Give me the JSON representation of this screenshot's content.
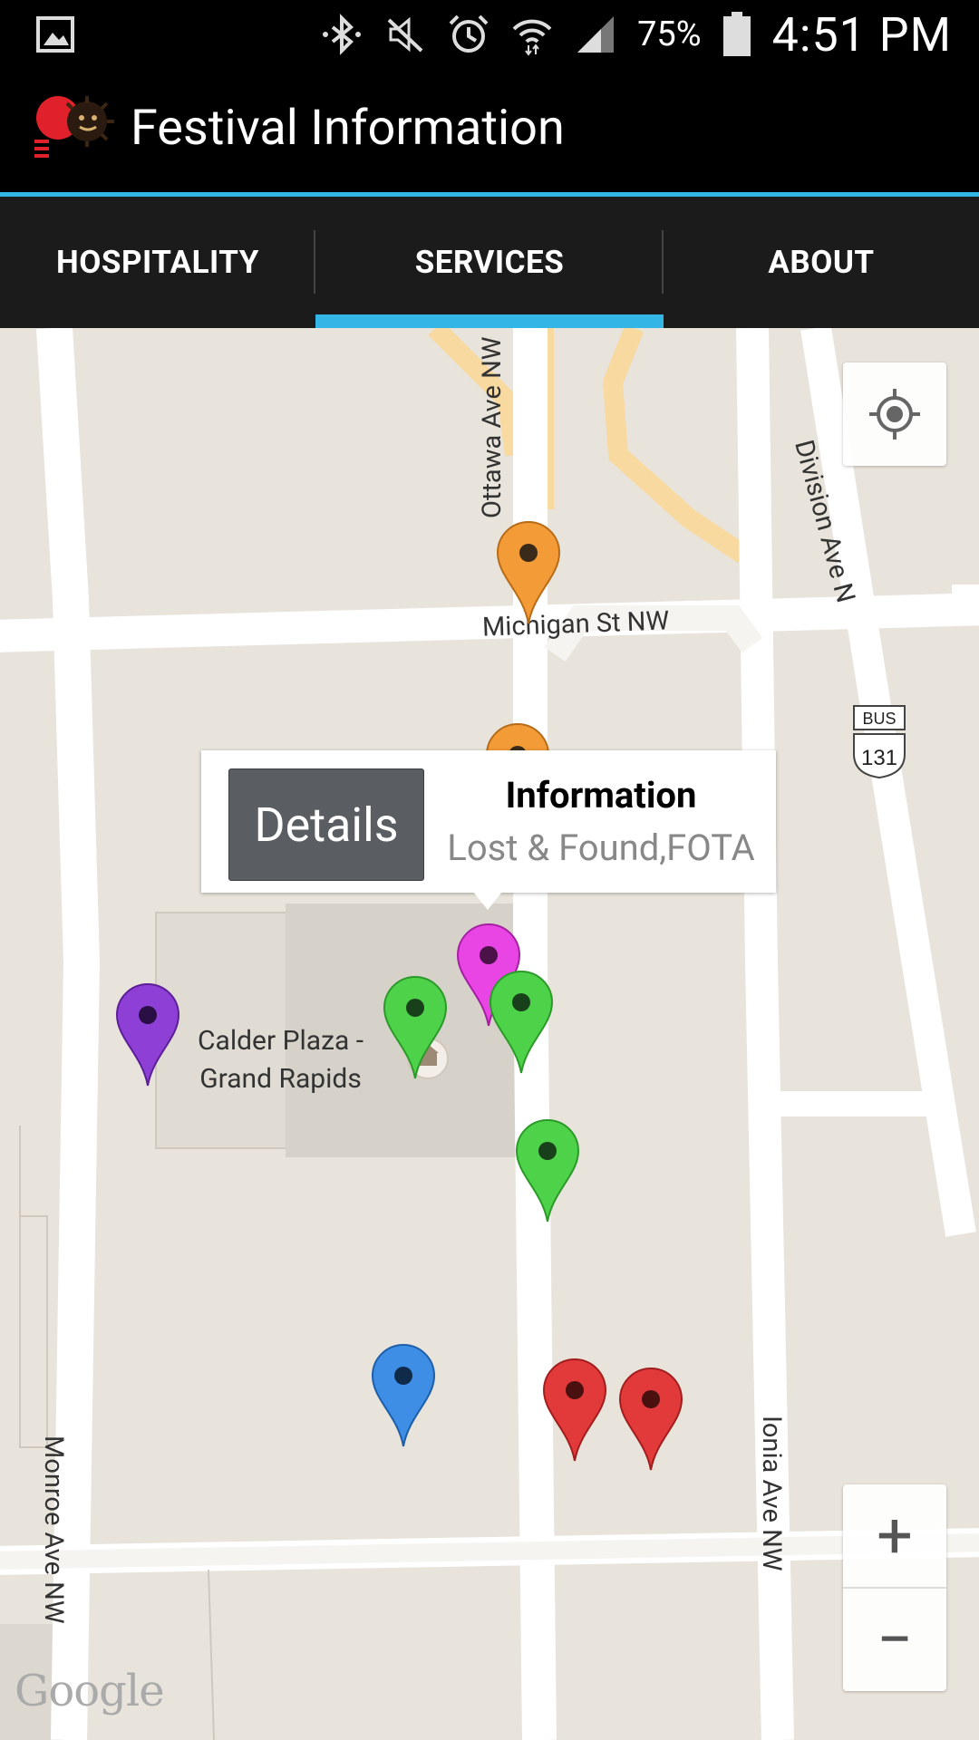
{
  "status_bar": {
    "battery_percent": "75%",
    "time": "4:51 PM"
  },
  "action_bar": {
    "title": "Festival Information"
  },
  "tabs": [
    {
      "label": "HOSPITALITY",
      "selected": false
    },
    {
      "label": "SERVICES",
      "selected": true
    },
    {
      "label": "ABOUT",
      "selected": false
    }
  ],
  "map": {
    "streets": {
      "ottawa": "Ottawa Ave NW",
      "michigan": "Michigan St NW",
      "division": "Division Ave N",
      "monroe": "Monroe Ave NW",
      "ionia": "Ionia Ave NW"
    },
    "route_shield": {
      "top": "BUS",
      "number": "131"
    },
    "poi": {
      "line1": "Calder Plaza -",
      "line2": "Grand Rapids"
    },
    "attribution": "Google",
    "zoom_in": "+",
    "zoom_out": "−"
  },
  "info_window": {
    "button_label": "Details",
    "title": "Information",
    "subtitle": "Lost & Found,FOTA"
  },
  "colors": {
    "accent": "#33B5E5",
    "pin_orange": "#F39B36",
    "pin_magenta": "#E845E4",
    "pin_green": "#4ED24A",
    "pin_purple": "#8E3FD6",
    "pin_blue": "#3E8EE6",
    "pin_red": "#E23A3A"
  }
}
